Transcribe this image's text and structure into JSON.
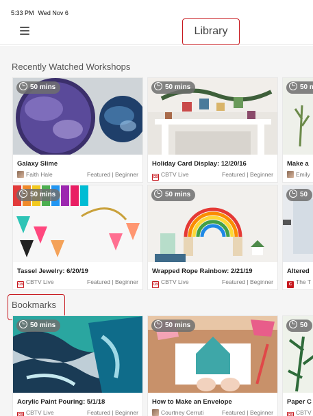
{
  "status": {
    "time": "5:33 PM",
    "date": "Wed Nov 6"
  },
  "nav": {
    "title": "Library"
  },
  "sections": {
    "recent": {
      "title": "Recently Watched Workshops"
    },
    "bookmarks": {
      "title": "Bookmarks"
    }
  },
  "colors": {
    "accent": "#c7191f",
    "badge": "#6e6e6e"
  },
  "recent_rows": [
    [
      {
        "duration": "50 mins",
        "title": "Galaxy Slime",
        "author": "Faith Hale",
        "tags": "Featured | Beginner"
      },
      {
        "duration": "50 mins",
        "title": "Holiday Card Display: 12/20/16",
        "author": "CBTV Live",
        "tags": "Featured | Beginner"
      },
      {
        "duration": "50 mins",
        "title": "Make a",
        "author": "Emily",
        "tags": ""
      }
    ],
    [
      {
        "duration": "50 mins",
        "title": "Tassel Jewelry: 6/20/19",
        "author": "CBTV Live",
        "tags": "Featured | Beginner"
      },
      {
        "duration": "50 mins",
        "title": "Wrapped Rope Rainbow: 2/21/19",
        "author": "CBTV Live",
        "tags": "Featured | Beginner"
      },
      {
        "duration": "50",
        "title": "Altered",
        "author": "The T",
        "tags": ""
      }
    ]
  ],
  "bookmark_row": [
    {
      "duration": "50 mins",
      "title": "Acrylic Paint Pouring: 5/1/18",
      "author": "CBTV Live",
      "tags": "Featured | Beginner"
    },
    {
      "duration": "50 mins",
      "title": "How to Make an Envelope",
      "author": "Courtney Cerruti",
      "tags": "Featured | Beginner"
    },
    {
      "duration": "50",
      "title": "Paper C",
      "author": "CBTV",
      "tags": ""
    }
  ],
  "avatar_text": {
    "cb": "CB",
    "c": "C"
  }
}
